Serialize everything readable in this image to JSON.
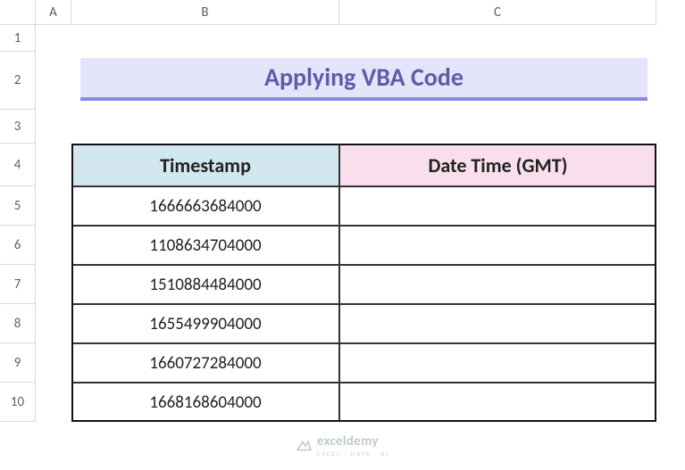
{
  "columns": {
    "A": "A",
    "B": "B",
    "C": "C"
  },
  "rows": [
    "1",
    "2",
    "3",
    "4",
    "5",
    "6",
    "7",
    "8",
    "9",
    "10"
  ],
  "title": "Applying VBA Code",
  "headers": {
    "b": "Timestamp",
    "c": "Date Time (GMT)"
  },
  "data": {
    "b5": "1666663684000",
    "c5": "",
    "b6": "1108634704000",
    "c6": "",
    "b7": "1510884484000",
    "c7": "",
    "b8": "1655499904000",
    "c8": "",
    "b9": "1660727284000",
    "c9": "",
    "b10": "1668168604000",
    "c10": ""
  },
  "watermark": {
    "brand": "exceldemy",
    "tagline": "EXCEL · DATA · BI"
  }
}
